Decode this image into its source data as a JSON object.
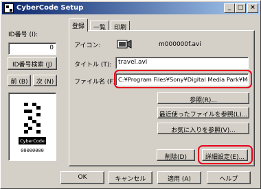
{
  "window": {
    "title": "CyberCode Setup",
    "controls": {
      "minimize": "_",
      "maximize": "□",
      "close": "×"
    }
  },
  "left": {
    "id_label": "ID番号 (I):",
    "id_value": "0",
    "search_button": "ID番号検索 (J)",
    "prev_button": "前 (B)",
    "next_button": "次 (N)",
    "code_brand": "CyberCode",
    "code_digits": "00000000"
  },
  "tabs": [
    {
      "label": "登録"
    },
    {
      "label": "一覧"
    },
    {
      "label": "印刷"
    }
  ],
  "register": {
    "icon_label": "アイコン:",
    "icon_filename": "m000000f.avi",
    "title_label": "タイトル (T):",
    "title_value": "travel.avi",
    "file_label": "ファイル名 (F):",
    "file_value": "C:¥Program Files¥Sony¥Digital Media Park¥Me",
    "browse_button": "参照(R)...",
    "recent_button": "最近使ったファイルを参照(L)...",
    "favorites_button": "お気に入りを参照(V)...",
    "delete_button": "削除(D)",
    "advanced_button": "詳細設定(E)..."
  },
  "footer": {
    "ok": "OK",
    "cancel": "キャンセル",
    "apply": "適用 (A)",
    "help": "ヘルプ"
  },
  "highlight_color": "#e8001c"
}
